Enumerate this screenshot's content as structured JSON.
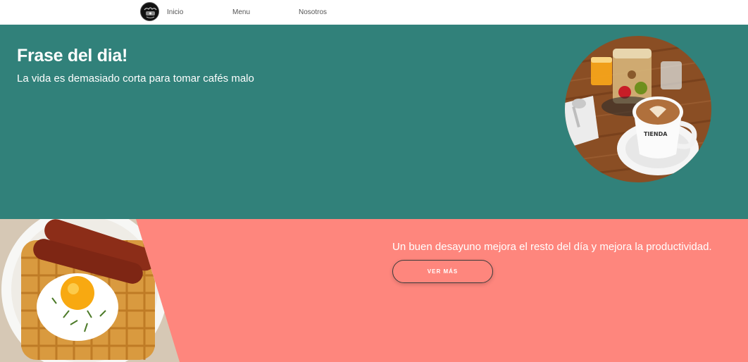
{
  "nav": {
    "logo_icon": "coffee-logo-icon",
    "items": [
      {
        "label": "Inicio"
      },
      {
        "label": "Menu"
      },
      {
        "label": "Nosotros"
      }
    ]
  },
  "hero": {
    "title": "Frase del dia!",
    "subtitle": "La vida es demasiado corta para tomar cafés malo",
    "background_color": "#31817a",
    "image": "coffee-and-breakfast-photo"
  },
  "promo": {
    "text": "Un buen desayuno mejora el resto del día y mejora la productividad.",
    "button_label": "VER MÁS",
    "background_color": "#fe867d",
    "image": "waffle-sausage-egg-photo"
  }
}
